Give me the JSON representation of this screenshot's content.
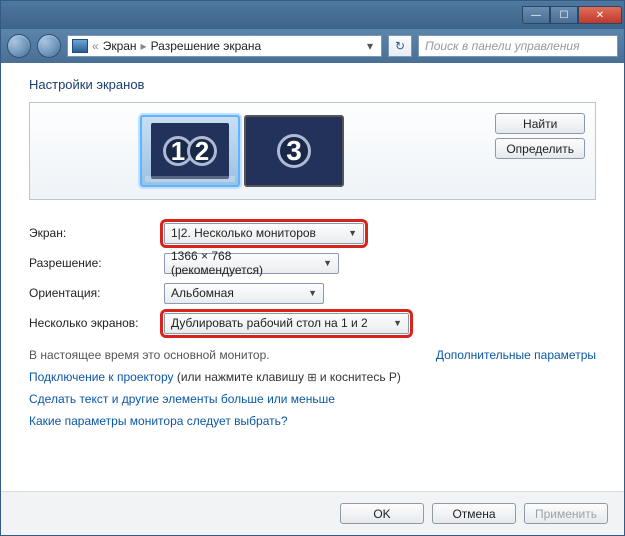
{
  "titlebar": {
    "min": "—",
    "max": "☐",
    "close": "✕"
  },
  "nav": {
    "crumb_root": "«",
    "crumb1": "Экран",
    "sep": "▸",
    "crumb2": "Разрешение экрана",
    "search_placeholder": "Поиск в панели управления",
    "refresh": "↻"
  },
  "heading": "Настройки экранов",
  "preview": {
    "monitor12_a": "1",
    "monitor12_b": "2",
    "monitor3": "3",
    "find_btn": "Найти",
    "identify_btn": "Определить"
  },
  "form": {
    "display_label": "Экран:",
    "display_value": "1|2. Несколько мониторов",
    "resolution_label": "Разрешение:",
    "resolution_value": "1366 × 768 (рекомендуется)",
    "orientation_label": "Ориентация:",
    "orientation_value": "Альбомная",
    "multi_label": "Несколько экранов:",
    "multi_value": "Дублировать рабочий стол на 1 и 2"
  },
  "note_primary": "В настоящее время это основной монитор.",
  "link_advanced": "Дополнительные параметры",
  "link_projector_a": "Подключение к проектору",
  "link_projector_b": " (или нажмите клавишу ",
  "link_projector_c": " и коснитесь P)",
  "win_key": "⊞",
  "link_textsize": "Сделать текст и другие элементы больше или меньше",
  "link_which": "Какие параметры монитора следует выбрать?",
  "buttons": {
    "ok": "OK",
    "cancel": "Отмена",
    "apply": "Применить"
  }
}
